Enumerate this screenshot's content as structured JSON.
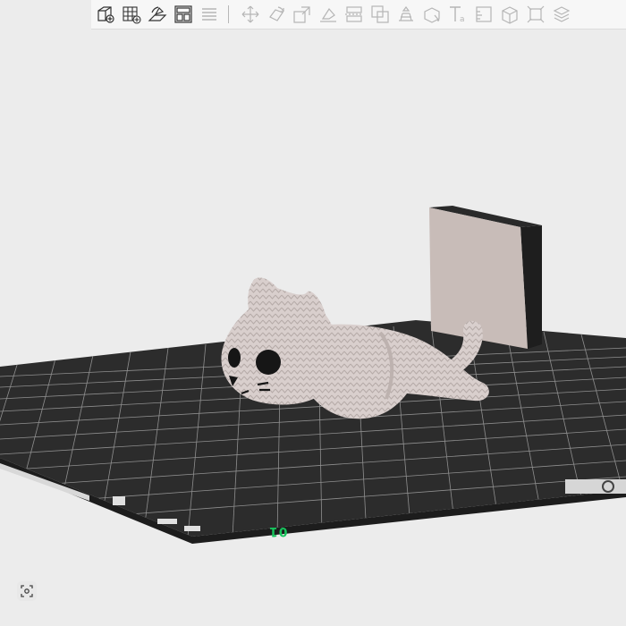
{
  "toolbar": {
    "tools": [
      {
        "name": "add-cube-icon",
        "enabled": true
      },
      {
        "name": "add-plate-icon",
        "enabled": true
      },
      {
        "name": "auto-orient-icon",
        "enabled": true
      },
      {
        "name": "arrange-icon",
        "enabled": true
      },
      {
        "name": "list-icon",
        "enabled": false
      },
      {
        "name": "move-icon",
        "enabled": false
      },
      {
        "name": "rotate-icon",
        "enabled": false
      },
      {
        "name": "scale-icon",
        "enabled": false
      },
      {
        "name": "lay-on-face-icon",
        "enabled": false
      },
      {
        "name": "cut-icon",
        "enabled": false
      },
      {
        "name": "boolean-icon",
        "enabled": false
      },
      {
        "name": "support-paint-icon",
        "enabled": false
      },
      {
        "name": "seam-paint-icon",
        "enabled": false
      },
      {
        "name": "text-icon",
        "enabled": false
      },
      {
        "name": "measure-icon",
        "enabled": false
      },
      {
        "name": "assembly-icon",
        "enabled": false
      },
      {
        "name": "fit-view-icon",
        "enabled": false
      },
      {
        "name": "layers-icon",
        "enabled": false
      }
    ]
  },
  "plate": {
    "label": "01",
    "color": "#2c2c2c",
    "grid_color": "#9a9a9a",
    "label_color": "#16c45c"
  },
  "model": {
    "name": "knitted-cat-model",
    "color": "#d9cfcd"
  },
  "wipe_tower": {
    "color": "#c8bcb8"
  },
  "corner_button": {
    "icon": "screenshot-icon"
  }
}
